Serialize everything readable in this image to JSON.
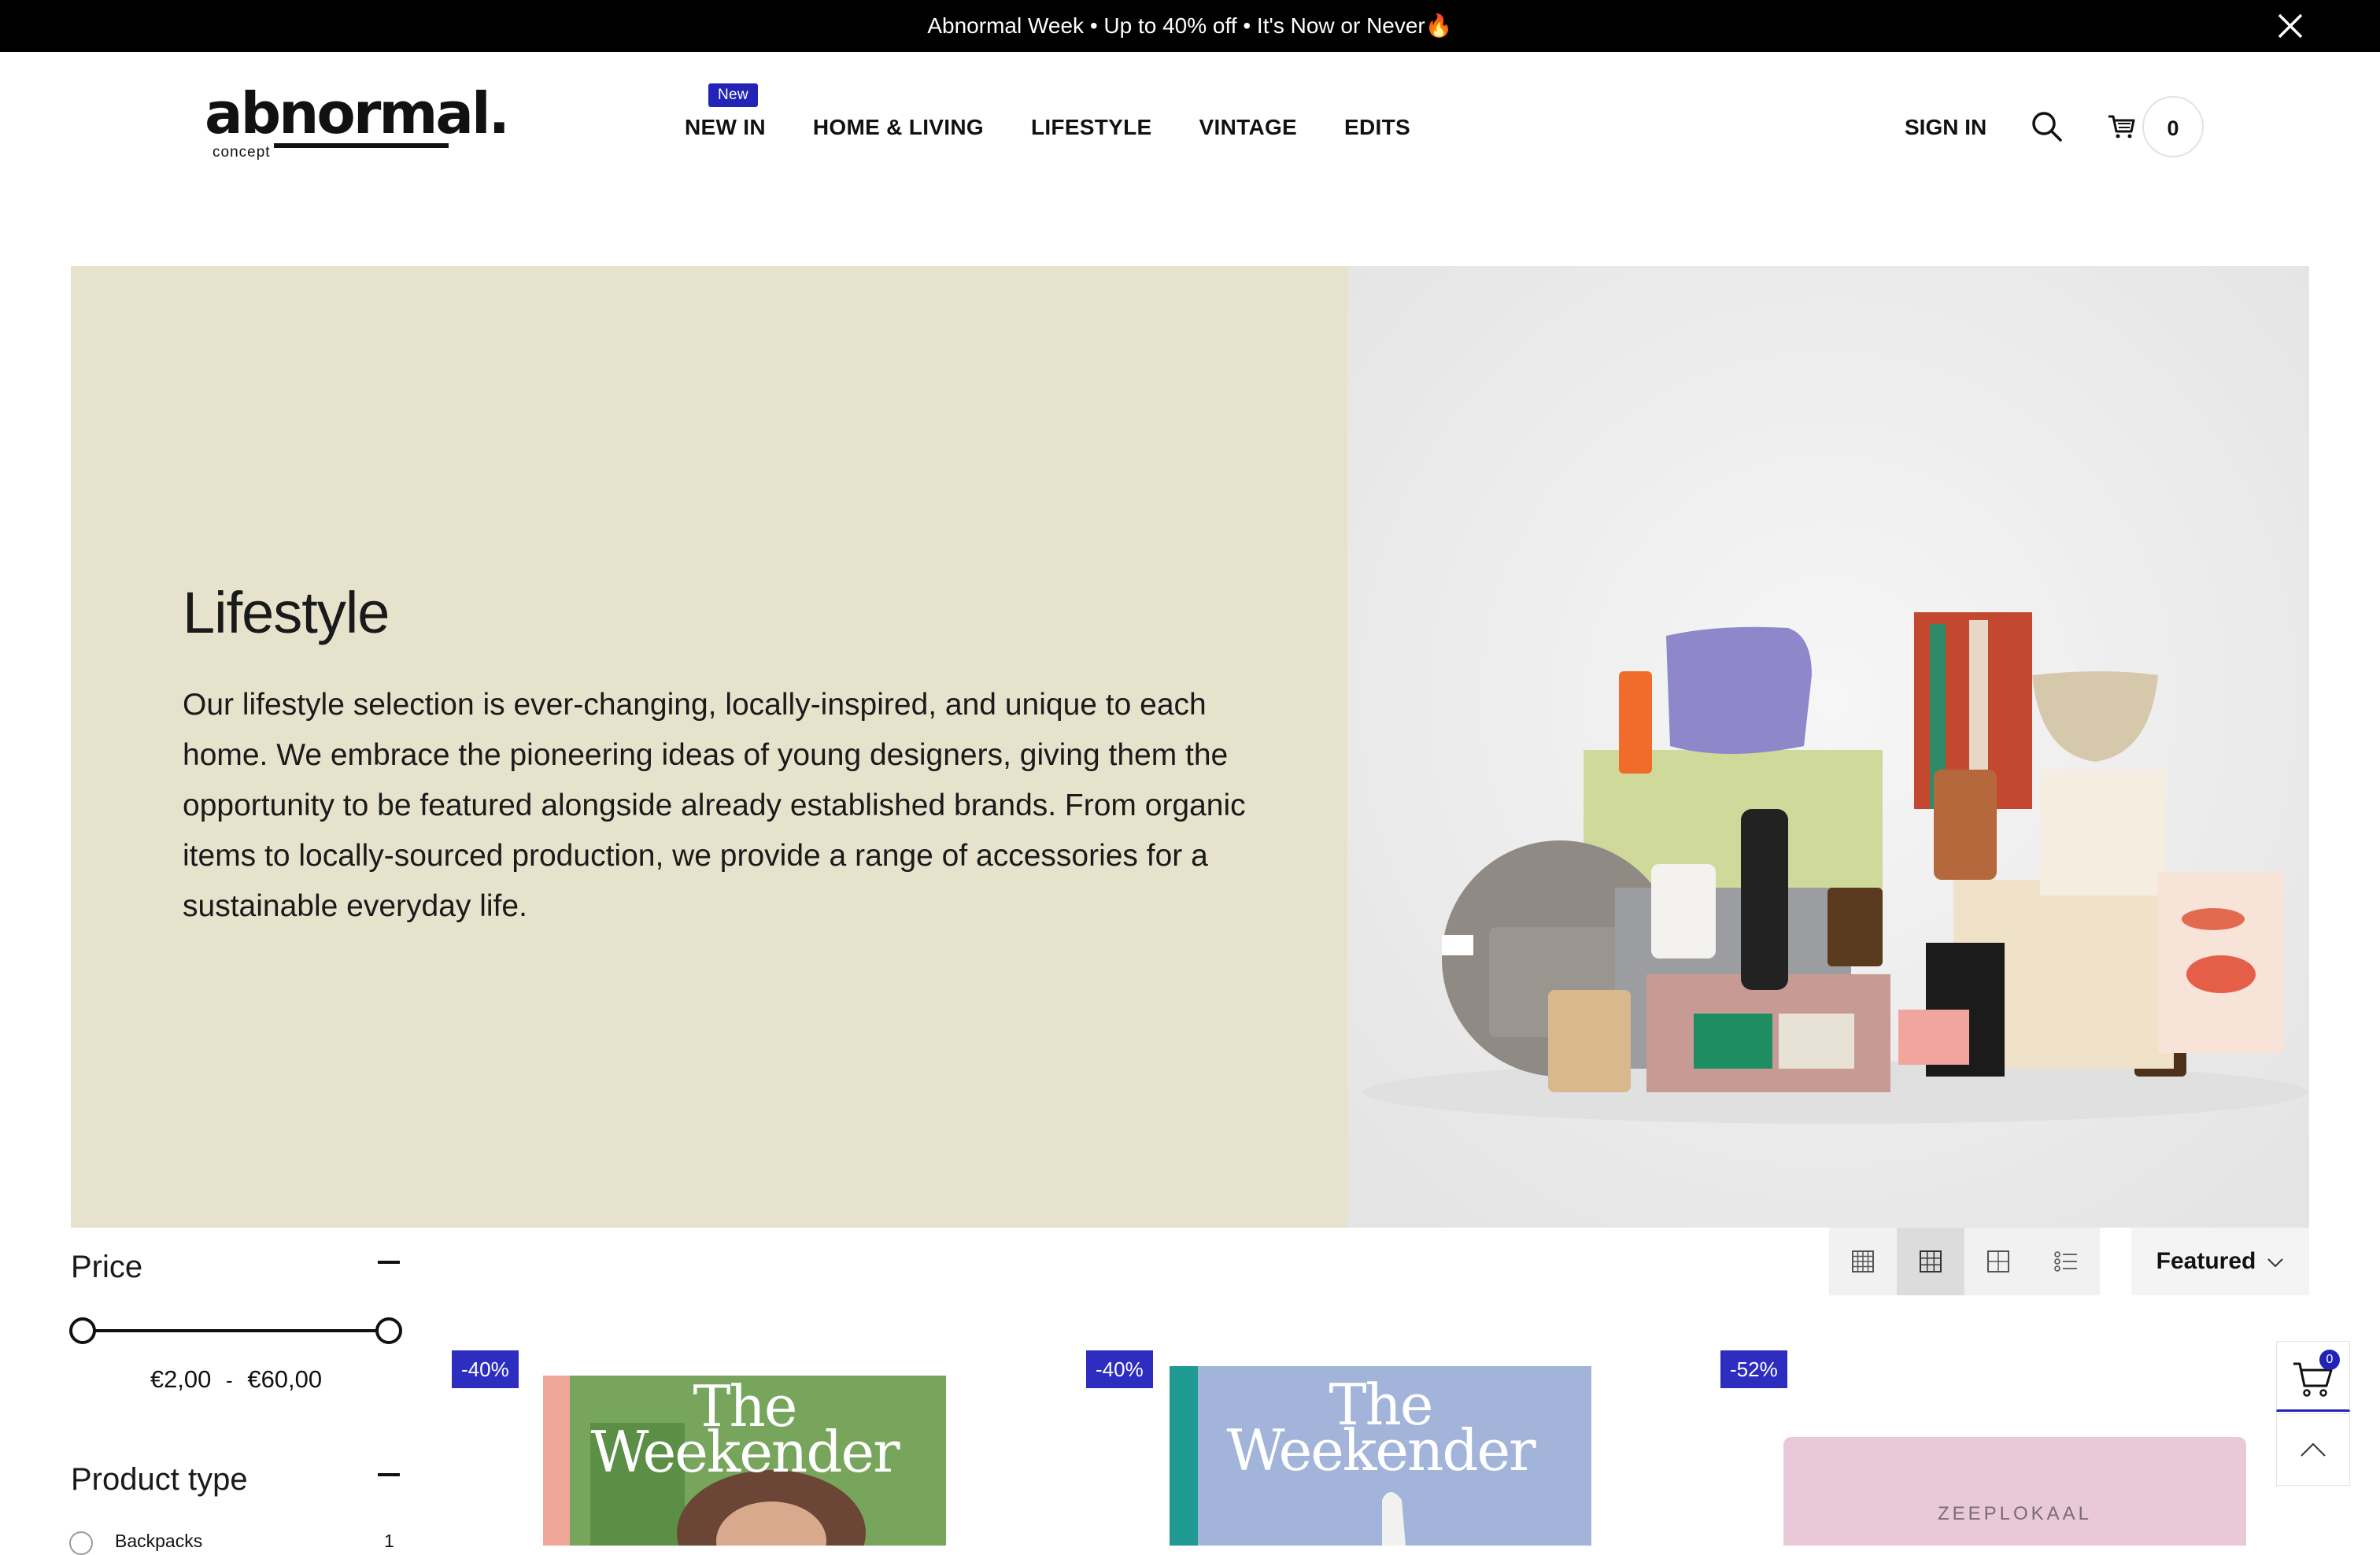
{
  "announcement": {
    "text": "Abnormal Week • Up to 40% off • It's Now or Never🔥"
  },
  "header": {
    "logo": {
      "word": "abnormal.",
      "sub": "concept"
    },
    "nav": [
      {
        "label": "NEW IN",
        "badge": "New"
      },
      {
        "label": "HOME & LIVING"
      },
      {
        "label": "LIFESTYLE"
      },
      {
        "label": "VINTAGE"
      },
      {
        "label": "EDITS"
      }
    ],
    "sign_in": "SIGN IN",
    "cart_count": "0"
  },
  "hero": {
    "title": "Lifestyle",
    "description": "Our lifestyle selection is ever-changing, locally-inspired, and unique to each home. We embrace the pioneering ideas of young designers, giving them the opportunity to be featured alongside already established brands. From organic items to locally-sourced production, we provide a range of accessories for a sustainable everyday life.",
    "background_color": "#e6e2cc"
  },
  "toolbar": {
    "views": [
      "grid-4-icon",
      "grid-3-icon",
      "grid-2-icon",
      "list-icon"
    ],
    "active_view_index": 1,
    "sort_label": "Featured"
  },
  "filters": {
    "price": {
      "heading": "Price",
      "min": "€2,00",
      "separator": "-",
      "max": "€60,00"
    },
    "product_type": {
      "heading": "Product type",
      "options": [
        {
          "label": "Backpacks",
          "count": "1"
        }
      ]
    }
  },
  "products": [
    {
      "badge": "-40%",
      "magazine_title": "The Weekender"
    },
    {
      "badge": "-40%",
      "magazine_title": "The Weekender"
    },
    {
      "badge": "-52%",
      "brand_text": "ZEEPLOKAAL"
    }
  ],
  "floating_cart": {
    "count": "0"
  },
  "colors": {
    "accent": "#2323b8",
    "announcement_bg": "#000000",
    "badge": "#2d2dbf"
  }
}
